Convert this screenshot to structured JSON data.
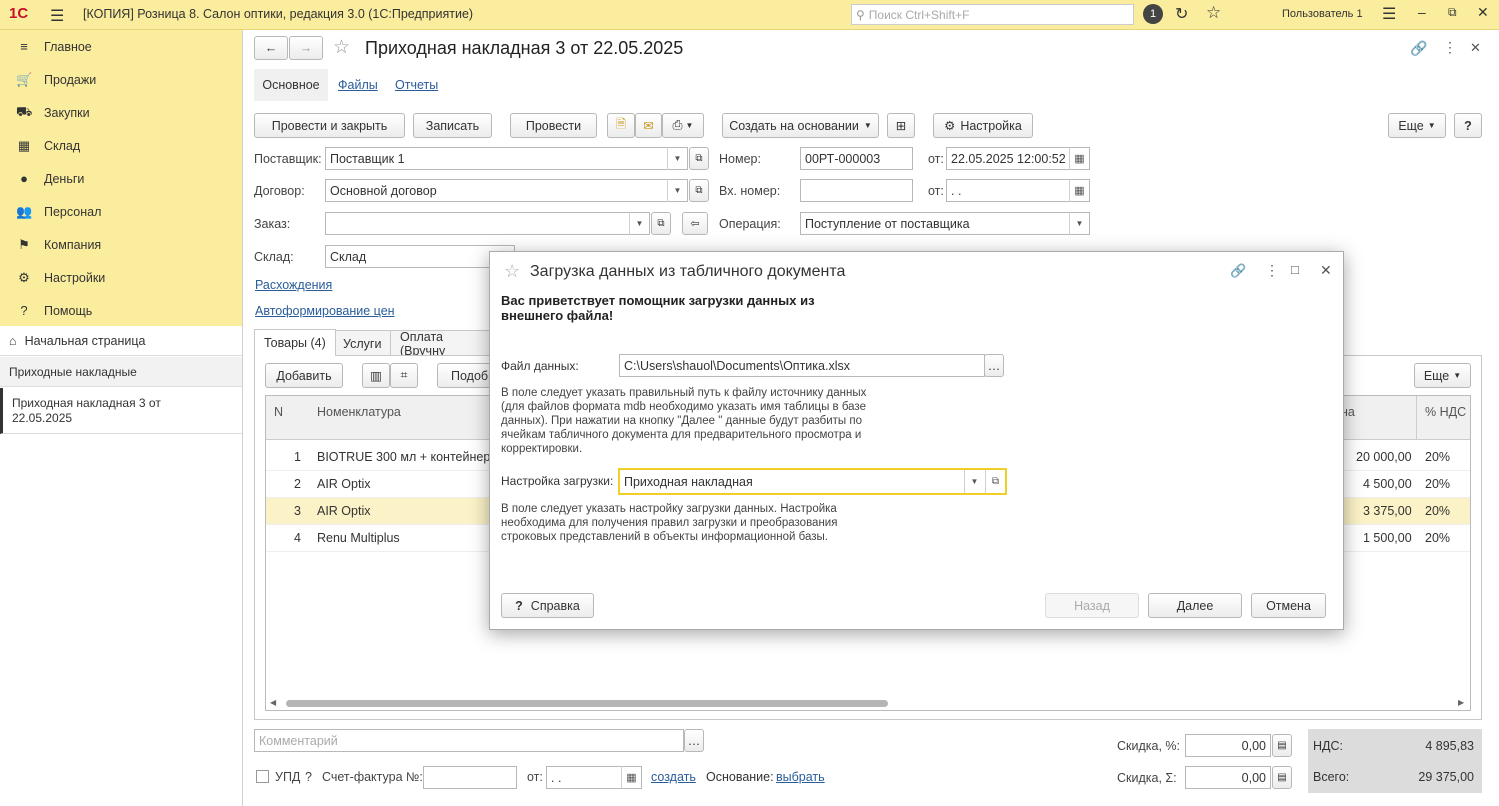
{
  "topbar": {
    "logo": "1С",
    "title": "[КОПИЯ] Розница 8. Салон оптики, редакция 3.0  (1С:Предприятие)",
    "search_placeholder": "Поиск Ctrl+Shift+F",
    "notif_count": "1",
    "user": "Пользователь 1"
  },
  "sidebar": {
    "items": [
      {
        "label": "Главное",
        "icon": "menu-icon"
      },
      {
        "label": "Продажи",
        "icon": "cart-icon"
      },
      {
        "label": "Закупки",
        "icon": "basket-icon"
      },
      {
        "label": "Склад",
        "icon": "warehouse-icon"
      },
      {
        "label": "Деньги",
        "icon": "money-icon"
      },
      {
        "label": "Персонал",
        "icon": "people-icon"
      },
      {
        "label": "Компания",
        "icon": "flag-icon"
      },
      {
        "label": "Настройки",
        "icon": "gear-icon"
      },
      {
        "label": "Помощь",
        "icon": "help-icon"
      }
    ],
    "home": "Начальная страница",
    "nav1": "Приходные накладные",
    "nav2_line1": "Приходная накладная 3 от",
    "nav2_line2": "22.05.2025"
  },
  "doc": {
    "title": "Приходная накладная 3 от 22.05.2025",
    "tabs": [
      "Основное",
      "Файлы",
      "Отчеты"
    ],
    "toolbar": {
      "post_close": "Провести и закрыть",
      "save": "Записать",
      "post": "Провести",
      "create_based": "Создать на основании",
      "settings": "Настройка",
      "more": "Еще",
      "help": "?"
    },
    "fields": {
      "supplier_label": "Поставщик:",
      "supplier": "Поставщик 1",
      "contract_label": "Договор:",
      "contract": "Основной договор",
      "order_label": "Заказ:",
      "order": "",
      "warehouse_label": "Склад:",
      "warehouse": "Склад",
      "number_label": "Номер:",
      "number": "00РТ-000003",
      "from_label": "от:",
      "date": "22.05.2025 12:00:52",
      "in_number_label": "Вх. номер:",
      "in_number": "",
      "in_date": " .  .",
      "operation_label": "Операция:",
      "operation": "Поступление от поставщика"
    },
    "links": {
      "expenses": "Расхождения",
      "autoprice": "Автоформирование цен"
    },
    "subtabs": [
      "Товары (4)",
      "Услуги",
      "Оплата (Вручну"
    ],
    "table_toolbar": {
      "add": "Добавить",
      "pick": "Подобр",
      "more": "Еще"
    },
    "table": {
      "headers": [
        "N",
        "Номенклатура",
        "на",
        "% НДС"
      ],
      "rows": [
        {
          "n": "1",
          "name": "BIOTRUE 300 мл + контейнер",
          "sum": "20 000,00",
          "vat": "20%"
        },
        {
          "n": "2",
          "name": "AIR Optix",
          "sum": "4 500,00",
          "vat": "20%"
        },
        {
          "n": "3",
          "name": "AIR Optix",
          "sum": "3 375,00",
          "vat": "20%"
        },
        {
          "n": "4",
          "name": "Renu Multiplus",
          "sum": "1 500,00",
          "vat": "20%"
        }
      ]
    },
    "footer": {
      "comment_placeholder": "Комментарий",
      "upd": "УПД",
      "q": "?",
      "invoice_label": "Счет-фактура №:",
      "from_label": "от:",
      "invoice_date": " .  .",
      "create": "создать",
      "basis_label": "Основание:",
      "basis": "выбрать",
      "discount_pct_label": "Скидка, %:",
      "discount_pct": "0,00",
      "discount_sum_label": "Скидка, Σ:",
      "discount_sum": "0,00",
      "vat_label": "НДС:",
      "vat": "4 895,83",
      "total_label": "Всего:",
      "total": "29 375,00"
    }
  },
  "modal": {
    "title": "Загрузка данных из табличного документа",
    "greeting": "Вас приветствует помощник загрузки данных из внешнего файла!",
    "file_label": "Файл данных:",
    "file": "C:\\Users\\shauol\\Documents\\Оптика.xlsx",
    "file_hint": "В поле следует указать правильный путь к файлу источнику данных (для файлов формата mdb необходимо указать имя таблицы в базе данных). При нажатии на кнопку \"Далее \" данные будут разбиты по ячейкам табличного документа для предварительного просмотра и корректировки.",
    "setting_label": "Настройка загрузки:",
    "setting": "Приходная накладная",
    "setting_hint": "В поле следует указать настройку загрузки данных. Настройка необходима для получения правил загрузки и преобразования строковых представлений в объекты информационной базы.",
    "help": "Справка",
    "back": "Назад",
    "next": "Далее",
    "cancel": "Отмена"
  }
}
